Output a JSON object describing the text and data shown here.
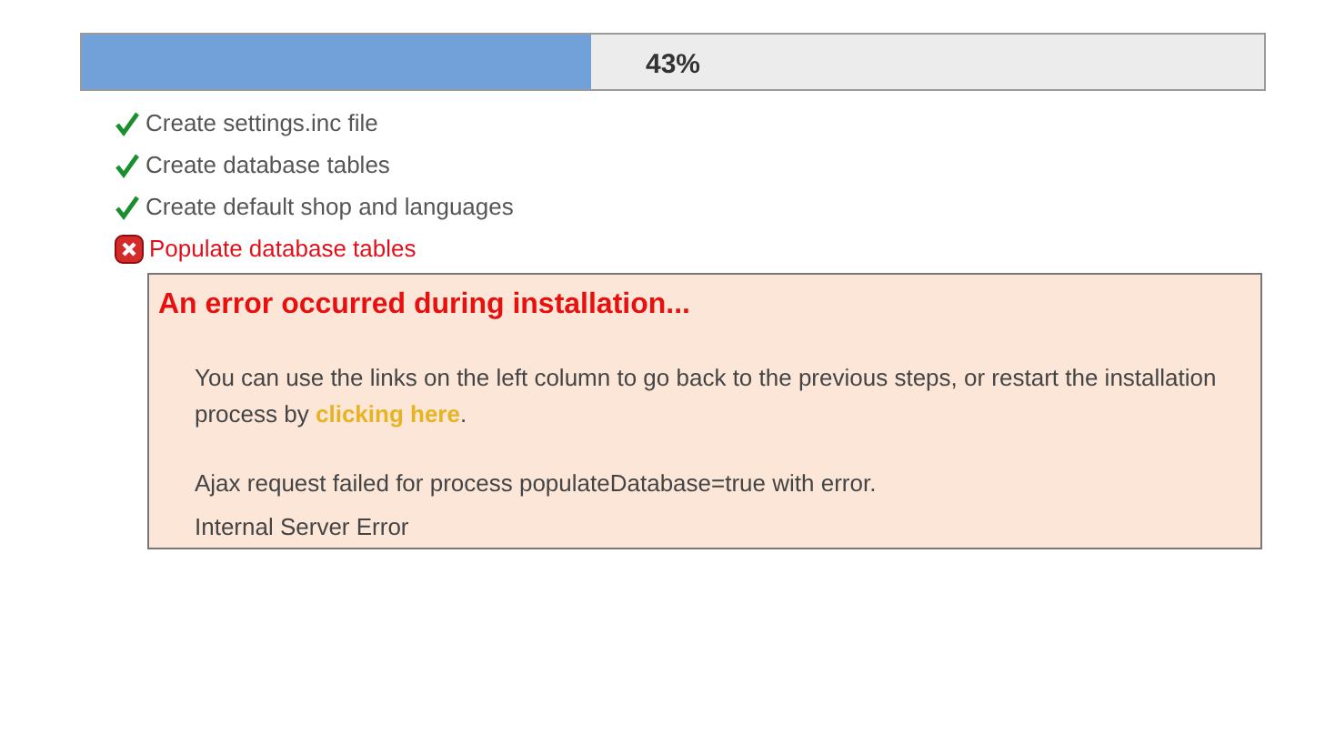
{
  "progress": {
    "level": 0.43,
    "label": "43%"
  },
  "steps": [
    {
      "label": "Create settings.inc file",
      "kind": "done"
    },
    {
      "label": "Create database tables",
      "kind": "done"
    },
    {
      "label": "Create default shop and languages",
      "kind": "done"
    },
    {
      "label": "Populate database tables",
      "kind": "error"
    }
  ],
  "error_box": {
    "title": "An error occurred during installation...",
    "message": {
      "before": "You can use the links on the left column to go back to the previous steps, or restart the installation process by ",
      "link": "clicking here",
      "after": "."
    },
    "details": [
      "Ajax request failed for process populateDatabase=true with error.",
      "Internal Server Error"
    ]
  }
}
